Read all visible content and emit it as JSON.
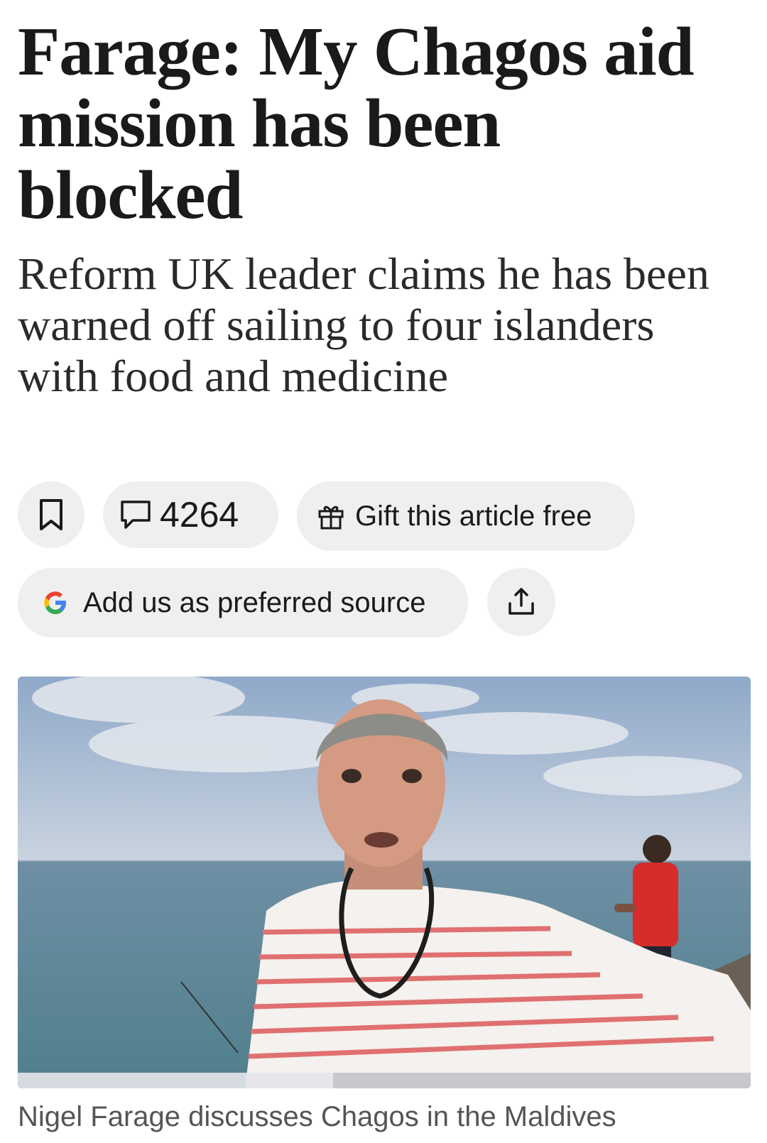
{
  "article": {
    "headline": "Farage: My Chagos aid mission has been blocked",
    "standfirst": "Reform UK leader claims he has been warned off sailing to four islanders with food and medicine"
  },
  "actions": {
    "comment_count": "4264",
    "gift_label": "Gift this article free",
    "preferred_source_label": "Add us as preferred source"
  },
  "media": {
    "type": "video",
    "progress_fraction": 0.43,
    "caption": "Nigel Farage discusses Chagos in the Maldives"
  },
  "icons": {
    "bookmark": "bookmark-icon",
    "comments": "speech-bubble-icon",
    "gift": "gift-icon",
    "google": "google-g-icon",
    "share": "share-upload-icon"
  },
  "colors": {
    "pill_background": "#efefef",
    "google_blue": "#4285F4",
    "google_red": "#EA4335",
    "google_yellow": "#FBBC05",
    "google_green": "#34A853"
  }
}
